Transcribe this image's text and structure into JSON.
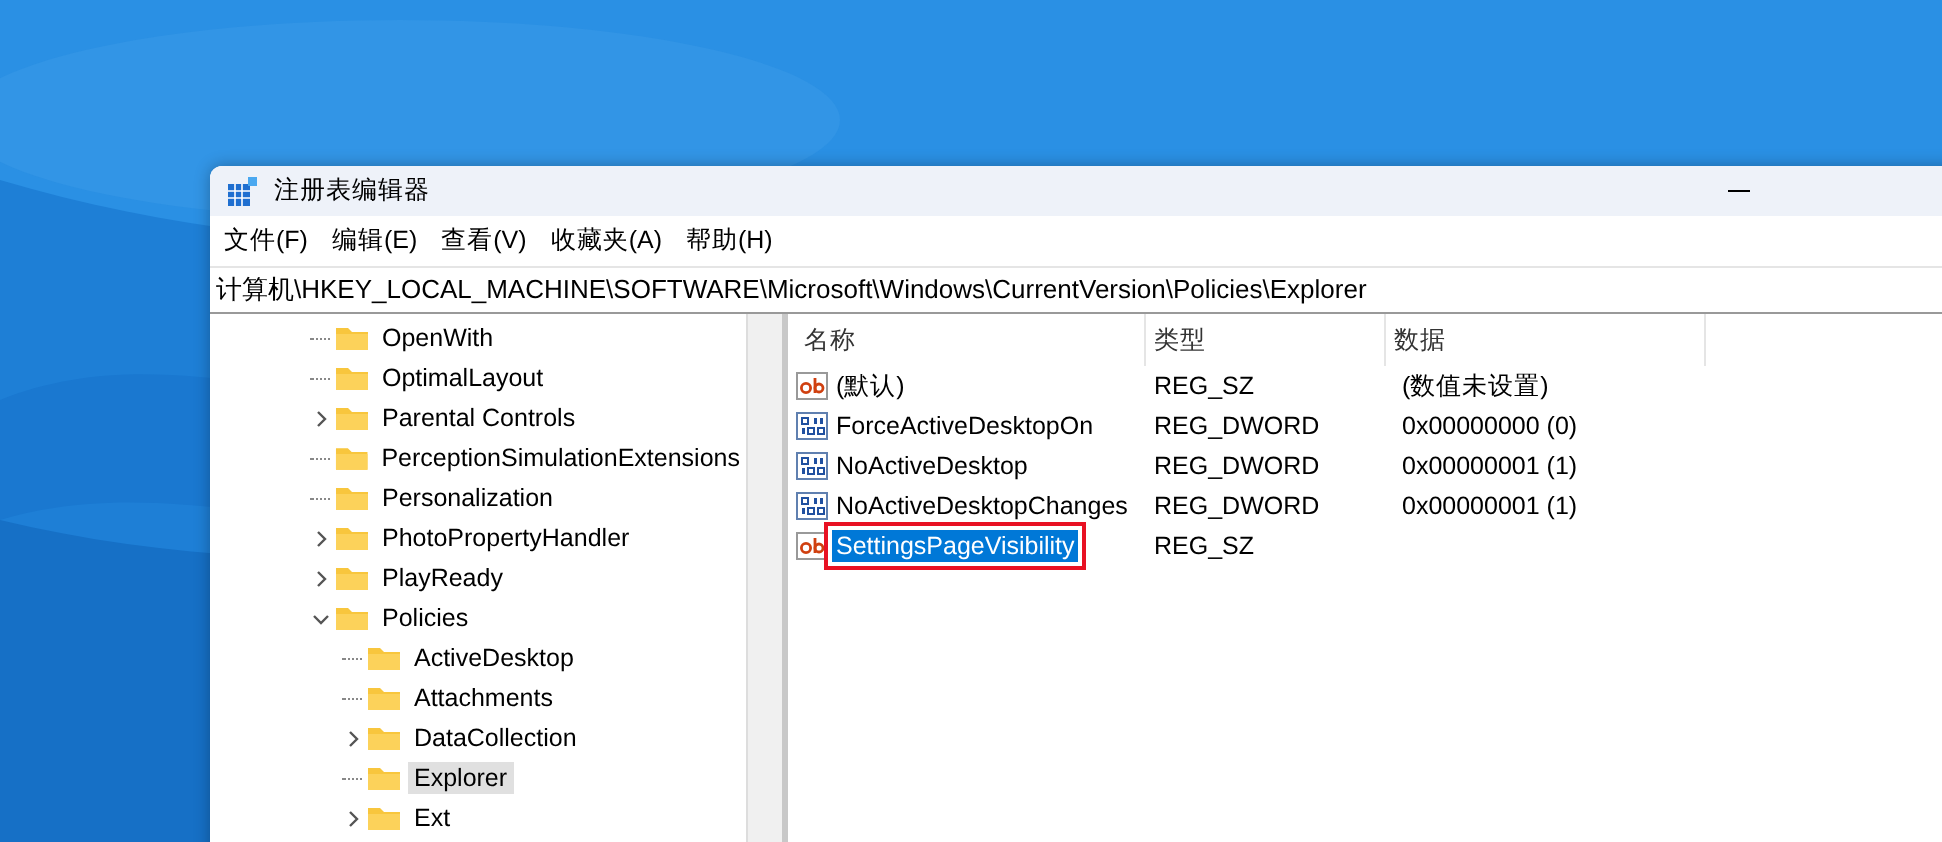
{
  "window": {
    "title": "注册表编辑器"
  },
  "menu": [
    "文件(F)",
    "编辑(E)",
    "查看(V)",
    "收藏夹(A)",
    "帮助(H)"
  ],
  "address": "计算机\\HKEY_LOCAL_MACHINE\\SOFTWARE\\Microsoft\\Windows\\CurrentVersion\\Policies\\Explorer",
  "tree": [
    {
      "label": "OpenWith",
      "kind": "leaf",
      "selected": false
    },
    {
      "label": "OptimalLayout",
      "kind": "leaf",
      "selected": false
    },
    {
      "label": "Parental Controls",
      "kind": "branch",
      "expanded": false,
      "selected": false
    },
    {
      "label": "PerceptionSimulationExtensions",
      "kind": "leaf",
      "selected": false
    },
    {
      "label": "Personalization",
      "kind": "leaf",
      "selected": false
    },
    {
      "label": "PhotoPropertyHandler",
      "kind": "branch",
      "expanded": false,
      "selected": false
    },
    {
      "label": "PlayReady",
      "kind": "branch",
      "expanded": false,
      "selected": false
    },
    {
      "label": "Policies",
      "kind": "branch",
      "expanded": true,
      "selected": false,
      "children": [
        {
          "label": "ActiveDesktop",
          "kind": "leaf",
          "selected": false
        },
        {
          "label": "Attachments",
          "kind": "leaf",
          "selected": false
        },
        {
          "label": "DataCollection",
          "kind": "branch",
          "expanded": false,
          "selected": false
        },
        {
          "label": "Explorer",
          "kind": "leaf",
          "selected": true
        },
        {
          "label": "Ext",
          "kind": "branch",
          "expanded": false,
          "selected": false
        }
      ]
    }
  ],
  "columns": [
    "名称",
    "类型",
    "数据"
  ],
  "values": [
    {
      "name": "(默认)",
      "kind": "string",
      "type": "REG_SZ",
      "data": "(数值未设置)",
      "selected": false,
      "outlined": false
    },
    {
      "name": "ForceActiveDesktopOn",
      "kind": "dword",
      "type": "REG_DWORD",
      "data": "0x00000000 (0)",
      "selected": false,
      "outlined": false
    },
    {
      "name": "NoActiveDesktop",
      "kind": "dword",
      "type": "REG_DWORD",
      "data": "0x00000001 (1)",
      "selected": false,
      "outlined": false
    },
    {
      "name": "NoActiveDesktopChanges",
      "kind": "dword",
      "type": "REG_DWORD",
      "data": "0x00000001 (1)",
      "selected": false,
      "outlined": false
    },
    {
      "name": "SettingsPageVisibility",
      "kind": "string",
      "type": "REG_SZ",
      "selected": true,
      "outlined": true
    }
  ]
}
